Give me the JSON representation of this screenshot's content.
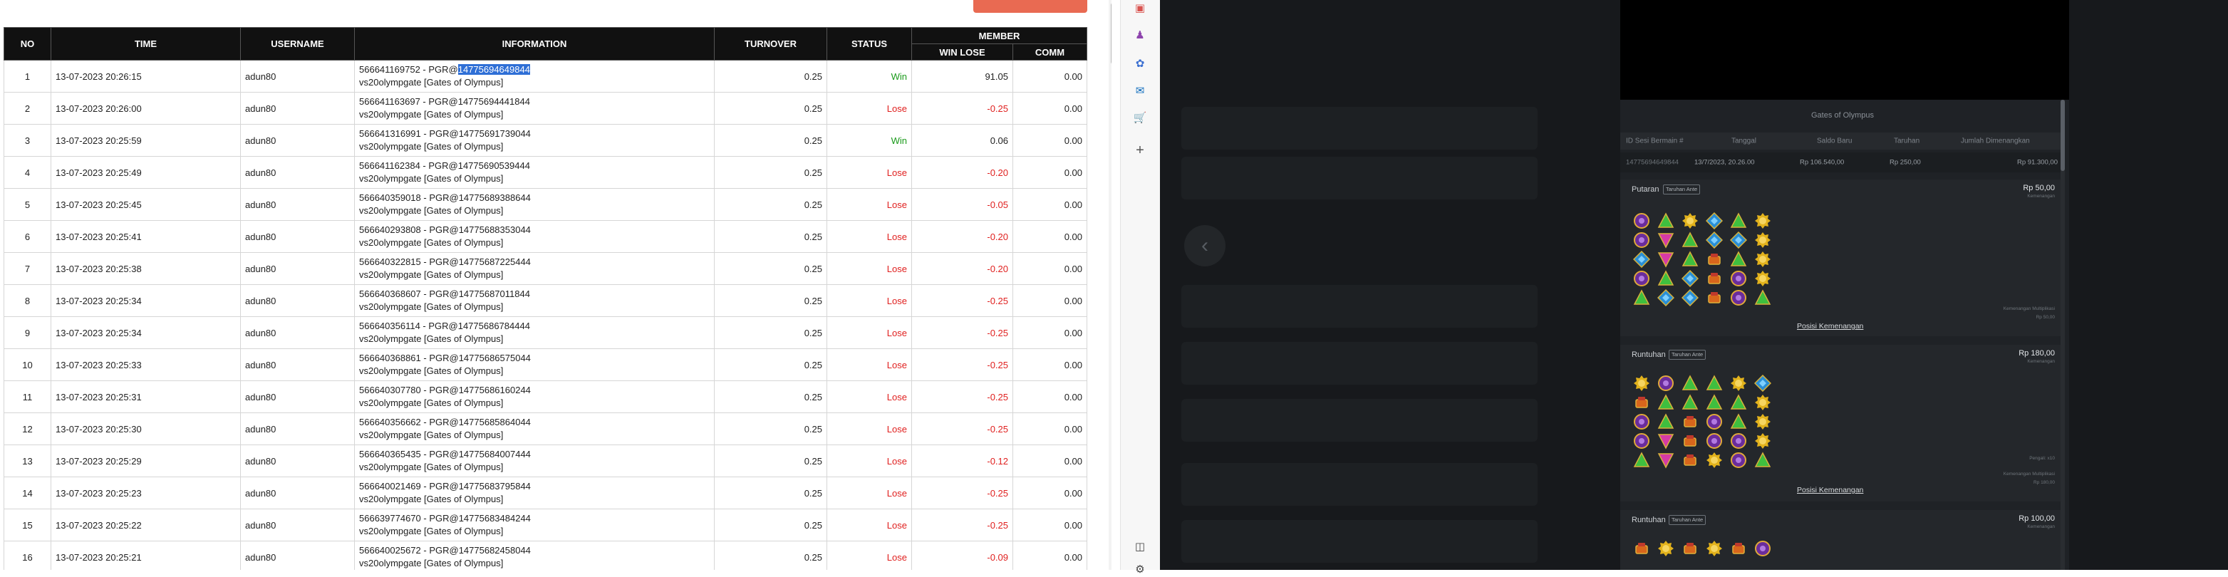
{
  "table": {
    "headers": {
      "no": "NO",
      "time": "TIME",
      "username": "USERNAME",
      "information": "INFORMATION",
      "turnover": "TURNOVER",
      "status": "STATUS",
      "member": "MEMBER",
      "win_lose": "WIN LOSE",
      "comm": "COMM"
    },
    "rows": [
      {
        "no": "1",
        "time": "13-07-2023 20:26:15",
        "username": "adun80",
        "info_prefix": "566641169752 - PGR@",
        "info_id": "14775694649844",
        "info_line2": "vs20olympgate [Gates of Olympus]",
        "turnover": "0.25",
        "status": "Win",
        "win_lose": "91.05",
        "comm": "0.00"
      },
      {
        "no": "2",
        "time": "13-07-2023 20:26:00",
        "username": "adun80",
        "info_prefix": "566641163697 - PGR@",
        "info_id": "14775694441844",
        "info_line2": "vs20olympgate [Gates of Olympus]",
        "turnover": "0.25",
        "status": "Lose",
        "win_lose": "-0.25",
        "comm": "0.00"
      },
      {
        "no": "3",
        "time": "13-07-2023 20:25:59",
        "username": "adun80",
        "info_prefix": "566641316991 - PGR@",
        "info_id": "14775691739044",
        "info_line2": "vs20olympgate [Gates of Olympus]",
        "turnover": "0.25",
        "status": "Win",
        "win_lose": "0.06",
        "comm": "0.00"
      },
      {
        "no": "4",
        "time": "13-07-2023 20:25:49",
        "username": "adun80",
        "info_prefix": "566641162384 - PGR@",
        "info_id": "14775690539444",
        "info_line2": "vs20olympgate [Gates of Olympus]",
        "turnover": "0.25",
        "status": "Lose",
        "win_lose": "-0.20",
        "comm": "0.00"
      },
      {
        "no": "5",
        "time": "13-07-2023 20:25:45",
        "username": "adun80",
        "info_prefix": "566640359018 - PGR@",
        "info_id": "14775689388644",
        "info_line2": "vs20olympgate [Gates of Olympus]",
        "turnover": "0.25",
        "status": "Lose",
        "win_lose": "-0.05",
        "comm": "0.00"
      },
      {
        "no": "6",
        "time": "13-07-2023 20:25:41",
        "username": "adun80",
        "info_prefix": "566640293808 - PGR@",
        "info_id": "14775688353044",
        "info_line2": "vs20olympgate [Gates of Olympus]",
        "turnover": "0.25",
        "status": "Lose",
        "win_lose": "-0.20",
        "comm": "0.00"
      },
      {
        "no": "7",
        "time": "13-07-2023 20:25:38",
        "username": "adun80",
        "info_prefix": "566640322815 - PGR@",
        "info_id": "14775687225444",
        "info_line2": "vs20olympgate [Gates of Olympus]",
        "turnover": "0.25",
        "status": "Lose",
        "win_lose": "-0.20",
        "comm": "0.00"
      },
      {
        "no": "8",
        "time": "13-07-2023 20:25:34",
        "username": "adun80",
        "info_prefix": "566640368607 - PGR@",
        "info_id": "14775687011844",
        "info_line2": "vs20olympgate [Gates of Olympus]",
        "turnover": "0.25",
        "status": "Lose",
        "win_lose": "-0.25",
        "comm": "0.00"
      },
      {
        "no": "9",
        "time": "13-07-2023 20:25:34",
        "username": "adun80",
        "info_prefix": "566640356114 - PGR@",
        "info_id": "14775686784444",
        "info_line2": "vs20olympgate [Gates of Olympus]",
        "turnover": "0.25",
        "status": "Lose",
        "win_lose": "-0.25",
        "comm": "0.00"
      },
      {
        "no": "10",
        "time": "13-07-2023 20:25:33",
        "username": "adun80",
        "info_prefix": "566640368861 - PGR@",
        "info_id": "14775686575044",
        "info_line2": "vs20olympgate [Gates of Olympus]",
        "turnover": "0.25",
        "status": "Lose",
        "win_lose": "-0.25",
        "comm": "0.00"
      },
      {
        "no": "11",
        "time": "13-07-2023 20:25:31",
        "username": "adun80",
        "info_prefix": "566640307780 - PGR@",
        "info_id": "14775686160244",
        "info_line2": "vs20olympgate [Gates of Olympus]",
        "turnover": "0.25",
        "status": "Lose",
        "win_lose": "-0.25",
        "comm": "0.00"
      },
      {
        "no": "12",
        "time": "13-07-2023 20:25:30",
        "username": "adun80",
        "info_prefix": "566640356662 - PGR@",
        "info_id": "14775685864044",
        "info_line2": "vs20olympgate [Gates of Olympus]",
        "turnover": "0.25",
        "status": "Lose",
        "win_lose": "-0.25",
        "comm": "0.00"
      },
      {
        "no": "13",
        "time": "13-07-2023 20:25:29",
        "username": "adun80",
        "info_prefix": "566640365435 - PGR@",
        "info_id": "14775684007444",
        "info_line2": "vs20olympgate [Gates of Olympus]",
        "turnover": "0.25",
        "status": "Lose",
        "win_lose": "-0.12",
        "comm": "0.00"
      },
      {
        "no": "14",
        "time": "13-07-2023 20:25:23",
        "username": "adun80",
        "info_prefix": "566640021469 - PGR@",
        "info_id": "14775683795844",
        "info_line2": "vs20olympgate [Gates of Olympus]",
        "turnover": "0.25",
        "status": "Lose",
        "win_lose": "-0.25",
        "comm": "0.00"
      },
      {
        "no": "15",
        "time": "13-07-2023 20:25:22",
        "username": "adun80",
        "info_prefix": "566639774670 - PGR@",
        "info_id": "14775683484244",
        "info_line2": "vs20olympgate [Gates of Olympus]",
        "turnover": "0.25",
        "status": "Lose",
        "win_lose": "-0.25",
        "comm": "0.00"
      },
      {
        "no": "16",
        "time": "13-07-2023 20:25:21",
        "username": "adun80",
        "info_prefix": "566640025672 - PGR@",
        "info_id": "14775682458044",
        "info_line2": "vs20olympgate [Gates of Olympus]",
        "turnover": "0.25",
        "status": "Lose",
        "win_lose": "-0.09",
        "comm": "0.00"
      }
    ]
  },
  "colors": {
    "header_bg": "#111111",
    "win": "#1a9a1a",
    "lose": "#e0201f",
    "accent_button": "#e96a52",
    "selection": "#2f6fd6",
    "panel_bg": "#17191c"
  },
  "sidebar": {
    "icons": [
      "briefcase-icon",
      "person-icon",
      "office-icon",
      "outlook-icon",
      "shopping-icon",
      "plus-icon",
      "panel-toggle-icon",
      "gear-icon"
    ]
  },
  "game": {
    "title": "Gates of Olympus",
    "summary": {
      "headers": [
        "ID Sesi Bermain #",
        "Tanggal",
        "Saldo Baru",
        "Taruhan",
        "Jumlah Dimenangkan"
      ],
      "values": [
        "14775694649844",
        "13/7/2023, 20.26.00",
        "Rp 106.540,00",
        "Rp 250,00",
        "Rp 91.300,00"
      ]
    },
    "sections": [
      {
        "title": "Putaran",
        "tag": "Taruhan Ante",
        "amount": "Rp 50,00",
        "amount_sub": "Kemenangan",
        "notes": [
          "Kemenangan Multiplikasi",
          "Rp 50,00"
        ],
        "link": "Posisi Kemenangan",
        "grid": [
          [
            "purple",
            "green",
            "yellow",
            "blue",
            "green",
            "yellow"
          ],
          [
            "purple",
            "pink",
            "green",
            "blue",
            "blue",
            "yellow"
          ],
          [
            "blue",
            "pink",
            "green",
            "red",
            "green",
            "yellow"
          ],
          [
            "purple",
            "green",
            "blue",
            "red",
            "purple",
            "yellow"
          ],
          [
            "green",
            "blue",
            "blue",
            "red",
            "purple",
            "green"
          ]
        ]
      },
      {
        "title": "Runtuhan",
        "tag": "Taruhan Ante",
        "amount": "Rp 180,00",
        "amount_sub": "Kemenangan",
        "notes": [
          "Pengali: x10",
          "Kemenangan Multiplikasi",
          "Rp 180,00"
        ],
        "link": "Posisi Kemenangan",
        "grid": [
          [
            "yellow",
            "purple",
            "green",
            "green",
            "yellow",
            "blue"
          ],
          [
            "red",
            "green",
            "green",
            "green",
            "green",
            "yellow"
          ],
          [
            "purple",
            "green",
            "red",
            "purple",
            "green",
            "yellow"
          ],
          [
            "purple",
            "pink",
            "red",
            "purple",
            "purple",
            "yellow"
          ],
          [
            "green",
            "pink",
            "red",
            "yellow",
            "purple",
            "green"
          ]
        ]
      },
      {
        "title": "Runtuhan",
        "tag": "Taruhan Ante",
        "amount": "Rp 100,00",
        "amount_sub": "Kemenangan",
        "notes": [],
        "link": "",
        "grid": [
          [
            "red",
            "yellow",
            "red",
            "yellow",
            "red",
            "purple"
          ]
        ]
      }
    ]
  }
}
